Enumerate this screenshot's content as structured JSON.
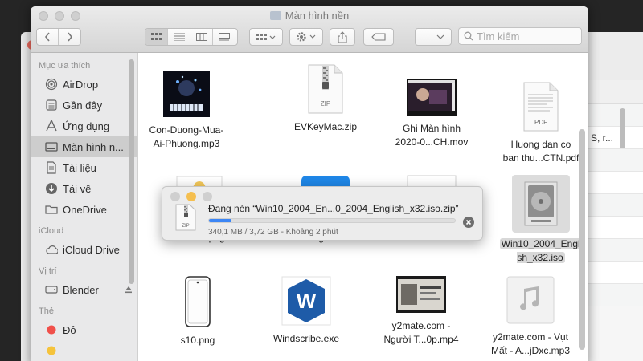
{
  "window": {
    "title": "Màn hình nền",
    "search_placeholder": "Tìm kiếm"
  },
  "sidebar": {
    "sections": [
      {
        "title": "Mục ưa thích",
        "items": [
          {
            "label": "AirDrop",
            "icon": "airdrop-icon"
          },
          {
            "label": "Gần đây",
            "icon": "recents-icon"
          },
          {
            "label": "Ứng dụng",
            "icon": "applications-icon"
          },
          {
            "label": "Màn hình n...",
            "icon": "desktop-icon",
            "selected": true
          },
          {
            "label": "Tài liệu",
            "icon": "documents-icon"
          },
          {
            "label": "Tải về",
            "icon": "downloads-icon"
          },
          {
            "label": "OneDrive",
            "icon": "folder-icon"
          }
        ]
      },
      {
        "title": "iCloud",
        "items": [
          {
            "label": "iCloud Drive",
            "icon": "cloud-icon"
          }
        ]
      },
      {
        "title": "Vị trí",
        "items": [
          {
            "label": "Blender",
            "icon": "disk-icon",
            "eject": true
          }
        ]
      },
      {
        "title": "Thẻ",
        "items": [
          {
            "label": "Đỏ",
            "icon": "tag-red-icon",
            "color": "#f0504a"
          }
        ]
      }
    ]
  },
  "files": [
    {
      "name": "Con-Duong-Mua-\nAi-Phuong.mp3",
      "kind": "album-art"
    },
    {
      "name": "EVKeyMac.zip",
      "kind": "zip"
    },
    {
      "name": "Ghi Màn hình\n2020-0...CH.mov",
      "kind": "video"
    },
    {
      "name": "Huong dan co\nban thu...CTN.pdf",
      "kind": "pdf"
    },
    {
      "name": "left-100.png",
      "kind": "png-thumb"
    },
    {
      "name": "Edge.lnk",
      "kind": "edge"
    },
    {
      "name": "",
      "kind": "fingerprint"
    },
    {
      "name": "Win10_2004_Engli\nsh_x32.iso",
      "kind": "iso",
      "selected": true
    },
    {
      "name": "s10.png",
      "kind": "phone"
    },
    {
      "name": "Windscribe.exe",
      "kind": "windscribe"
    },
    {
      "name": "y2mate.com -\nNgười T...0p.mp4",
      "kind": "video2"
    },
    {
      "name": "y2mate.com - Vụt\nMất - A...jDxc.mp3",
      "kind": "music"
    }
  ],
  "icon_labels": {
    "zip": "ZIP",
    "pdf": "PDF"
  },
  "progress": {
    "title": "Đang nén “Win10_2004_En...0_2004_English_x32.iso.zip”",
    "subtitle": "340,1 MB / 3,72 GB - Khoảng 2 phút",
    "fraction": 0.09,
    "icon_label": "ZIP"
  },
  "background_window": {
    "row_text": "S, r..."
  },
  "colors": {
    "accent": "#3c86f5",
    "tag_red": "#f0504a",
    "windscribe": "#1e5ba8"
  }
}
